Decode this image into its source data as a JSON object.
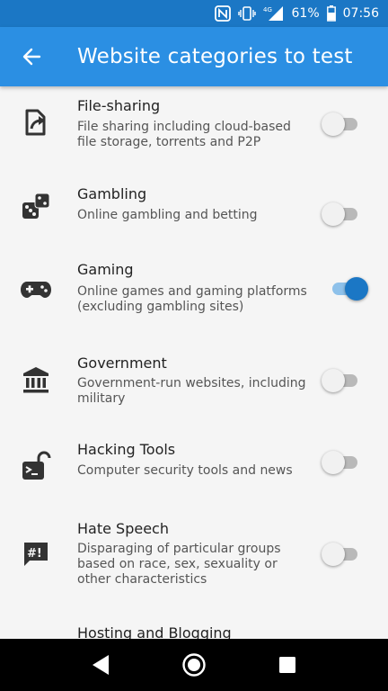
{
  "status_bar": {
    "battery": "61%",
    "time": "07:56",
    "network": "4G",
    "icons": [
      "nfc-icon",
      "vibrate-icon",
      "signal-icon",
      "battery-icon"
    ]
  },
  "app_bar": {
    "title": "Website categories to test",
    "back_icon": "arrow-left-icon"
  },
  "colors": {
    "app_bar": "#2b8fe3",
    "status_bar": "#1b77c5",
    "toggle_on": "#1b77c5",
    "toggle_off": "#b9b9b9"
  },
  "categories": [
    {
      "name": "File-sharing",
      "description": "File sharing including cloud-based file storage, torrents and P2P",
      "icon": "file-share-icon",
      "enabled": false
    },
    {
      "name": "Gambling",
      "description": "Online gambling and betting",
      "icon": "dice-icon",
      "enabled": false
    },
    {
      "name": "Gaming",
      "description": "Online games and gaming platforms (excluding gambling sites)",
      "icon": "gamepad-icon",
      "enabled": true
    },
    {
      "name": "Government",
      "description": "Government-run websites, including military",
      "icon": "government-building-icon",
      "enabled": false
    },
    {
      "name": "Hacking Tools",
      "description": "Computer security tools and news",
      "icon": "unlocked-terminal-icon",
      "enabled": false
    },
    {
      "name": "Hate Speech",
      "description": "Disparaging of particular groups based on race, sex, sexuality or other characteristics",
      "icon": "speech-exclamation-icon",
      "enabled": false
    },
    {
      "name": "Hosting and Blogging",
      "description": "",
      "icon": "",
      "enabled": false
    }
  ],
  "nav_bar": {
    "buttons": [
      "back-nav-icon",
      "home-nav-icon",
      "recents-nav-icon"
    ]
  }
}
